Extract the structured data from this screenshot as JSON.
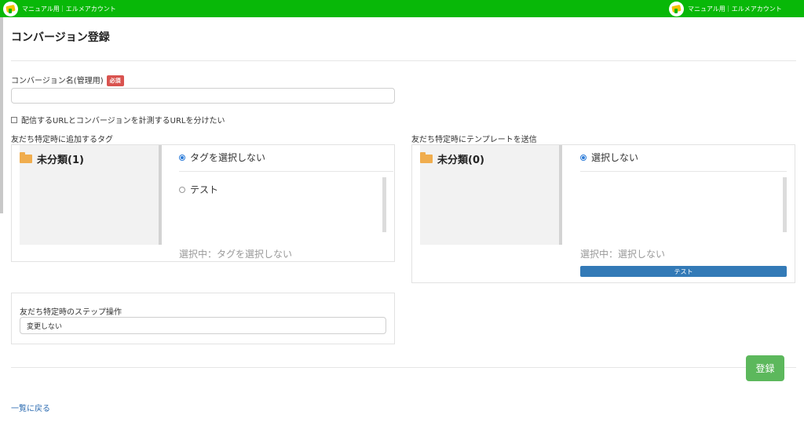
{
  "header": {
    "account_label_left": "マニュアル用｜エルメアカウント",
    "account_label_right": "マニュアル用｜エルメアカウント"
  },
  "page": {
    "title": "コンバージョン登録",
    "back_link": "一覧に戻る",
    "submit_label": "登録"
  },
  "form": {
    "name_label": "コンバージョン名(管理用)",
    "required_badge": "必須",
    "name_value": "",
    "split_url_label": "配信するURLとコンバージョンを計測するURLを分けたい",
    "split_url_checked": false
  },
  "tag_panel": {
    "heading": "友だち特定時に追加するタグ",
    "folder_label": "未分類(1)",
    "options": [
      "タグを選択しない",
      "テスト"
    ],
    "selected_index": 0,
    "selected_text": "選択中：タグを選択しない"
  },
  "template_panel": {
    "heading": "友だち特定時にテンプレートを送信",
    "folder_label": "未分類(0)",
    "options": [
      "選択しない"
    ],
    "selected_index": 0,
    "selected_text": "選択中：選択しない",
    "selected_button": "テスト"
  },
  "step_panel": {
    "heading": "友だち特定時のステップ操作",
    "select_value": "変更しない"
  },
  "colors": {
    "topbar": "#08b808",
    "primary_blue": "#337ab7",
    "success_green": "#5cb85c",
    "required_red": "#d9534f",
    "folder_orange": "#f0ad4e"
  },
  "icons": [
    "app-logo-icon",
    "folder-open-icon",
    "radio-icon",
    "checkbox-icon"
  ]
}
